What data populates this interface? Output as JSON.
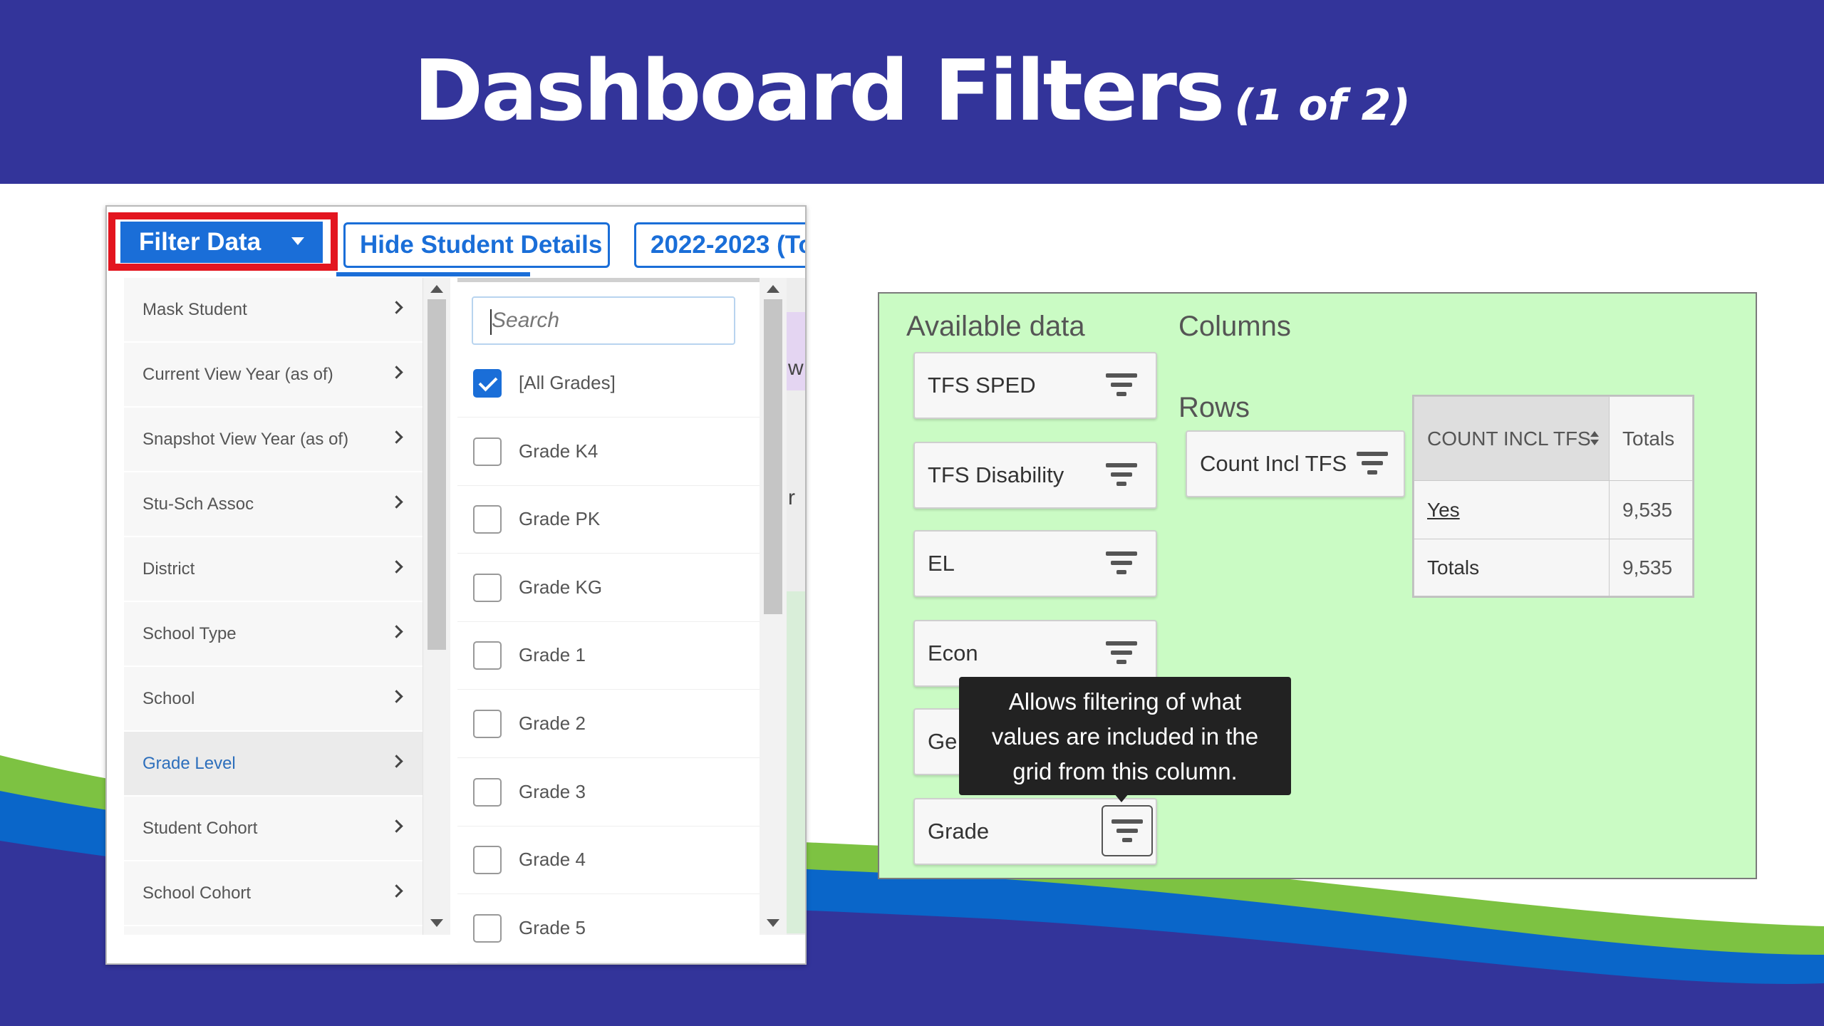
{
  "slide": {
    "title": "Dashboard Filters",
    "subtitle": "(1 of 2)"
  },
  "toolbar": {
    "filter_data_label": "Filter Data",
    "hide_details_label": "Hide Student Details",
    "year_label": "2022-2023 (To"
  },
  "filter_menu": {
    "items": [
      "Mask Student",
      "Current View Year (as of)",
      "Snapshot View Year (as of)",
      "Stu-Sch Assoc",
      "District",
      "School Type",
      "School",
      "Grade Level",
      "Student Cohort",
      "School Cohort"
    ],
    "active_item": "Grade Level"
  },
  "grade_list": {
    "search_placeholder": "Search",
    "options": [
      {
        "label": "[All Grades]",
        "checked": true
      },
      {
        "label": "Grade K4",
        "checked": false
      },
      {
        "label": "Grade PK",
        "checked": false
      },
      {
        "label": "Grade KG",
        "checked": false
      },
      {
        "label": "Grade 1",
        "checked": false
      },
      {
        "label": "Grade 2",
        "checked": false
      },
      {
        "label": "Grade 3",
        "checked": false
      },
      {
        "label": "Grade 4",
        "checked": false
      },
      {
        "label": "Grade 5",
        "checked": false
      }
    ],
    "peek_text_1": "w",
    "peek_text_2": "r"
  },
  "pivot_config": {
    "available_label": "Available data",
    "columns_label": "Columns",
    "rows_label": "Rows",
    "available_fields": [
      "TFS SPED",
      "TFS Disability",
      "EL",
      "Econ",
      "Ge",
      "Grade"
    ],
    "row_field": "Count Incl TFS"
  },
  "pivot_table": {
    "header_col": "COUNT INCL TFS",
    "header_totals": "Totals",
    "rows": [
      {
        "label": "Yes",
        "value": "9,535"
      },
      {
        "label": "Totals",
        "value": "9,535"
      }
    ]
  },
  "tooltip": {
    "line1": "Allows filtering of what",
    "line2": "values are included in the",
    "line3": "grid from this column."
  },
  "colors": {
    "header_band": "#33349a",
    "accent_blue": "#1a6ed8",
    "highlight_red": "#e3151f",
    "panel_green": "#cafbc4",
    "swoosh_green": "#7dc242",
    "swoosh_blue": "#0a66c9"
  }
}
